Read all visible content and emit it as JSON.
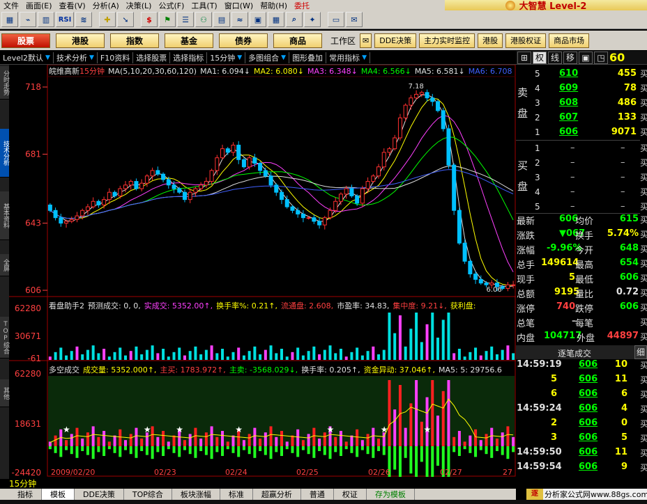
{
  "menu": {
    "items": [
      "文件",
      "画面(E)",
      "查看(V)",
      "分析(A)",
      "决策(L)",
      "公式(F)",
      "工具(T)",
      "窗口(W)",
      "帮助(H)",
      "委托"
    ],
    "brand": "大智慧 Level-2"
  },
  "toolbar": {
    "rsi": "RSI"
  },
  "nav": {
    "buttons": [
      "股票",
      "港股",
      "指数",
      "基金",
      "债券",
      "商品"
    ],
    "workarea": "工作区",
    "right_buttons": [
      "DDE决策",
      "主力实时监控",
      "港股",
      "港股权证",
      "商品市场"
    ]
  },
  "analysis_bar": {
    "items": [
      "Level2默认",
      "技术分析",
      "F10资料",
      "选择股票",
      "选择指标",
      "15分钟",
      "多图组合",
      "图形叠加",
      "常用指标"
    ]
  },
  "left_tabs": [
    "分时走势",
    "技术分析",
    "基本资料",
    "全屏",
    "TOP综合",
    "其他"
  ],
  "chart": {
    "header": {
      "stock": "皖维高新",
      "period": "15分钟",
      "ma_params": "MA(5,10,20,30,60,120)",
      "ma1": "MA1: 6.094↓",
      "ma2": "MA2: 6.080↓",
      "ma3": "MA3: 6.348↓",
      "ma4": "MA4: 6.566↓",
      "ma5": "MA5: 6.581↓",
      "ma6": "MA6: 6.708"
    },
    "price_labels": [
      "718",
      "681",
      "643",
      "606"
    ],
    "hi_note": "7.18",
    "lo_note": "6.06",
    "panel2": {
      "title": "看盘助手2",
      "items": [
        {
          "text": "预测成交: 0, 0,",
          "color": "#e0e0e0"
        },
        {
          "text": "实成交: 5352.00↑,",
          "color": "#ff40ff"
        },
        {
          "text": "换手率%: 0.21↑,",
          "color": "#ffff00"
        },
        {
          "text": "流通盘: 2.608,",
          "color": "#ff4040"
        },
        {
          "text": "市盈率: 34.83,",
          "color": "#e0e0e0"
        },
        {
          "text": "集中度: 9.21↓,",
          "color": "#ff4040"
        },
        {
          "text": "获利盘:",
          "color": "#ffff00"
        }
      ],
      "labels": [
        "62280",
        "30671",
        "-61"
      ]
    },
    "panel3": {
      "title": "多空成交",
      "items": [
        {
          "text": "成交量: 5352.000↑,",
          "color": "#ffff00"
        },
        {
          "text": "主买: 1783.972↑,",
          "color": "#ff4040"
        },
        {
          "text": "主卖: -3568.029↓,",
          "color": "#00ff00"
        },
        {
          "text": "换手率: 0.205↑,",
          "color": "#e0e0e0"
        },
        {
          "text": "资金异动: 37.046↑,",
          "color": "#ffff00"
        },
        {
          "text": "MA5: 5: 29756.6",
          "color": "#e0e0e0"
        }
      ],
      "labels": [
        "62280",
        "18631",
        "-24420"
      ]
    },
    "date_labels": [
      "2009/02/20",
      "02/23",
      "02/24",
      "02/25",
      "02/26",
      "02/27",
      "27"
    ],
    "period_label": "15分钟"
  },
  "chart_data": {
    "type": "candlestick",
    "title": "皖维高新",
    "ylim": [
      6.06,
      7.18
    ],
    "y_ticks": [
      7.18,
      6.81,
      6.43,
      6.06
    ],
    "x_categories": [
      "2009/02/20",
      "02/23",
      "02/24",
      "02/25",
      "02/26",
      "02/27"
    ],
    "close_series": [
      6.5,
      6.46,
      6.43,
      6.44,
      6.45,
      6.47,
      6.5,
      6.52,
      6.55,
      6.53,
      6.56,
      6.6,
      6.58,
      6.62,
      6.64,
      6.66,
      6.62,
      6.65,
      6.69,
      6.72,
      6.7,
      6.67,
      6.64,
      6.62,
      6.6,
      6.56,
      6.6,
      6.62,
      6.64,
      6.66,
      6.72,
      6.79,
      6.84,
      6.82,
      6.86,
      6.78,
      6.74,
      6.79,
      6.76,
      6.72,
      6.69,
      6.64,
      6.6,
      6.56,
      6.52,
      6.5,
      6.48,
      6.46,
      6.46,
      6.44,
      6.42,
      6.46,
      6.5,
      6.55,
      6.59,
      6.62,
      6.58,
      6.54,
      6.62,
      6.66,
      6.69,
      6.74,
      6.82,
      6.84,
      6.9,
      7.01,
      7.08,
      7.12,
      7.14,
      7.15,
      7.12,
      7.1,
      7.05,
      6.95,
      6.75,
      6.5,
      6.32,
      6.22,
      6.15,
      6.12,
      6.1,
      6.09,
      6.1,
      6.08,
      6.07,
      6.09,
      6.09
    ],
    "ma_series": [
      {
        "name": "MA1",
        "value": 6.094
      },
      {
        "name": "MA2",
        "value": 6.08
      },
      {
        "name": "MA3",
        "value": 6.348
      },
      {
        "name": "MA4",
        "value": 6.566
      },
      {
        "name": "MA5",
        "value": 6.581
      },
      {
        "name": "MA6",
        "value": 6.708
      }
    ]
  },
  "quote": {
    "tabs": [
      "权",
      "线",
      "移"
    ],
    "big": "60",
    "sell_label": "卖盘",
    "buy_label": "买盘",
    "sell": [
      {
        "lv": "5",
        "price": "610",
        "vol": "455"
      },
      {
        "lv": "4",
        "price": "609",
        "vol": "78"
      },
      {
        "lv": "3",
        "price": "608",
        "vol": "486"
      },
      {
        "lv": "2",
        "price": "607",
        "vol": "133"
      },
      {
        "lv": "1",
        "price": "606",
        "vol": "9071"
      }
    ],
    "buy": [
      {
        "lv": "1",
        "price": "–"
      },
      {
        "lv": "2",
        "price": "–"
      },
      {
        "lv": "3",
        "price": "–"
      },
      {
        "lv": "4",
        "price": "–"
      },
      {
        "lv": "5",
        "price": "–"
      }
    ],
    "edge": "买",
    "stats": [
      {
        "k": "最新",
        "v": "606",
        "k2": "均价",
        "v2": "615",
        "c1": "#00ff00",
        "c2": "#00ff00"
      },
      {
        "k": "涨跌",
        "v": "▼067",
        "k2": "换手",
        "v2": "5.74%",
        "c1": "#00ff00",
        "c2": "#ffff00"
      },
      {
        "k": "涨幅",
        "v": "-9.96%",
        "k2": "今开",
        "v2": "648",
        "c1": "#00ff00",
        "c2": "#00ff00"
      },
      {
        "k": "总手",
        "v": "149614",
        "k2": "最高",
        "v2": "654",
        "c1": "#ffff00",
        "c2": "#00ff00"
      },
      {
        "k": "现手",
        "v": "5",
        "k2": "最低",
        "v2": "606",
        "c1": "#ffff00",
        "c2": "#00ff00"
      },
      {
        "k": "总额",
        "v": "9195",
        "k2": "量比",
        "v2": "0.72",
        "c1": "#ffff00",
        "c2": "#e0e0e0"
      },
      {
        "k": "涨停",
        "v": "740",
        "k2": "跌停",
        "v2": "606",
        "c1": "#ff4040",
        "c2": "#00ff00"
      },
      {
        "k": "总笔",
        "v": "–",
        "k2": "每笔",
        "v2": "",
        "c1": "#c0c0c0",
        "c2": "#c0c0c0"
      },
      {
        "k": "内盘",
        "v": "104717",
        "k2": "外盘",
        "v2": "44897",
        "c1": "#00ff00",
        "c2": "#ff4040"
      }
    ],
    "tick_title": "逐笔成交",
    "tick_btn": "细",
    "ticks": [
      {
        "t": "14:59:19",
        "p": "606",
        "v": "10"
      },
      {
        "t": "5",
        "p": "606",
        "v": "11"
      },
      {
        "t": "6",
        "p": "606",
        "v": "6"
      },
      {
        "t": "14:59:24",
        "p": "606",
        "v": "4"
      },
      {
        "t": "2",
        "p": "606",
        "v": "0"
      },
      {
        "t": "3",
        "p": "606",
        "v": "5"
      },
      {
        "t": "14:59:50",
        "p": "606",
        "v": "11"
      },
      {
        "t": "14:59:54",
        "p": "606",
        "v": "9"
      }
    ]
  },
  "bottom_tabs": [
    "指标",
    "模板",
    "DDE决策",
    "TOP综合",
    "板块涨幅",
    "标准",
    "超赢分析",
    "普通",
    "权证",
    "存为模板"
  ],
  "watermark": "分析家公式网www.88gs.com",
  "watermark_logo": "逐"
}
